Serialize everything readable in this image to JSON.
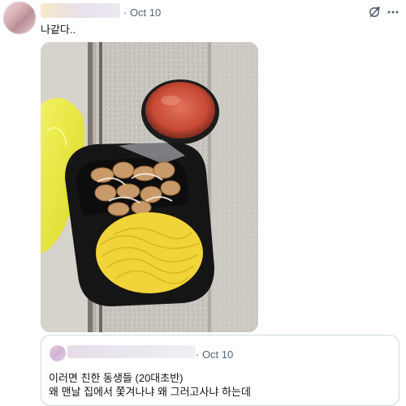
{
  "post": {
    "meta": "· Oct 10",
    "text": "나같다..",
    "icons": {
      "action": "refresh-icon",
      "more": "more-icon"
    },
    "photo": {
      "subject": "takeout-food-tray-photo"
    }
  },
  "quote": {
    "meta": "· Oct 10",
    "line1": "이러면 친한 동생들 (20대초반)",
    "line2": "왜 맨날 집에서 쫓겨나냐 왜 그러고사냐 하는데"
  },
  "colors": {
    "text": "#0f1419",
    "muted": "#536471",
    "border": "#cfd9de"
  }
}
